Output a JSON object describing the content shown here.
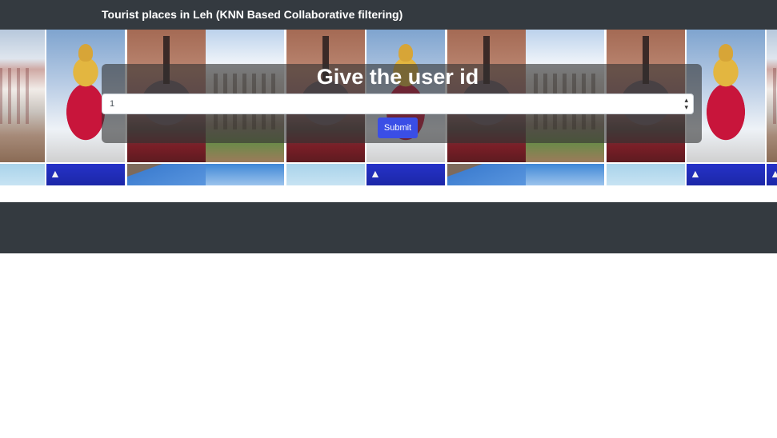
{
  "navbar": {
    "brand": "Tourist places in Leh (KNN Based Collaborative filtering)"
  },
  "banner": {
    "tiles": [
      "palace-image",
      "buddha-statue-image",
      "stupa-image",
      "monastery-image"
    ]
  },
  "form": {
    "heading": "Give the user id",
    "select": {
      "value": "1"
    },
    "submit_label": "Submit"
  },
  "colors": {
    "navbar": "#343a40",
    "footer": "#343a40",
    "submit": "#3a4ee6",
    "overlay": "rgba(48,48,48,0.6)"
  }
}
